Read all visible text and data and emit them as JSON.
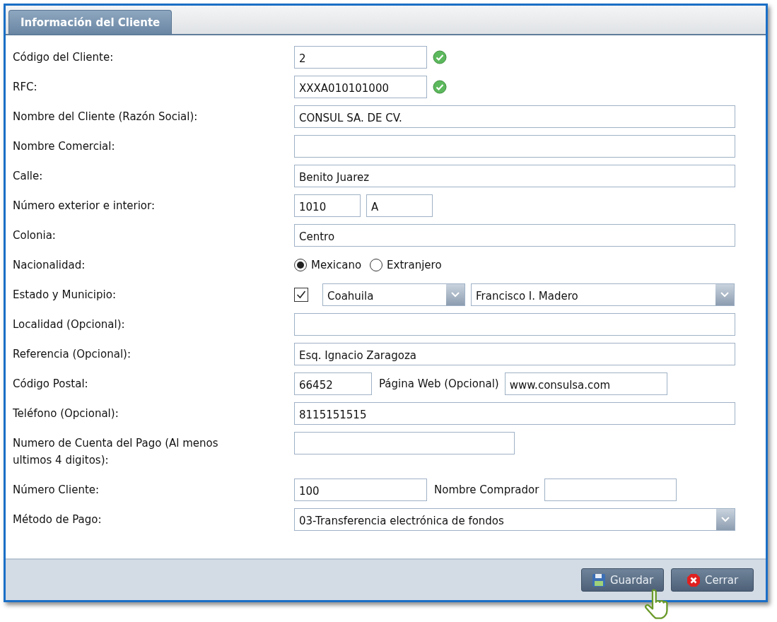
{
  "tab": {
    "label": "Información del Cliente",
    "selected": true
  },
  "rows": [
    {
      "label": "Código del Cliente:",
      "controls": [
        {
          "kind": "validated",
          "value": "2"
        }
      ]
    },
    {
      "label": "RFC:",
      "controls": [
        {
          "kind": "validated",
          "value": "XXXA010101000"
        }
      ]
    },
    {
      "label": "Nombre del Cliente (Razón Social):",
      "controls": [
        {
          "kind": "input",
          "value": "CONSUL SA. DE CV."
        }
      ]
    },
    {
      "label": "Nombre Comercial:",
      "controls": [
        {
          "kind": "input"
        }
      ]
    },
    {
      "label": "Calle:",
      "controls": [
        {
          "kind": "input",
          "value": "Benito Juarez"
        }
      ]
    },
    {
      "label": "Número exterior e interior:",
      "controls": [
        {
          "kind": "input",
          "value": "1010"
        },
        {
          "kind": "input",
          "value": "A"
        }
      ]
    },
    {
      "label": "Colonia:",
      "controls": [
        {
          "kind": "input",
          "value": "Centro"
        }
      ]
    },
    {
      "label": "Nacionalidad:",
      "controls": [
        {
          "kind": "radio",
          "label": "Mexicano",
          "selected": true
        },
        {
          "kind": "radio",
          "label": "Extranjero",
          "selected": false
        }
      ]
    },
    {
      "label": "Estado y Municipio:",
      "controls": [
        {
          "kind": "checkbox",
          "checked": true
        },
        {
          "kind": "select",
          "value": "Coahuila"
        },
        {
          "kind": "select",
          "value": "Francisco I. Madero"
        }
      ]
    },
    {
      "label": "Localidad (Opcional):",
      "controls": [
        {
          "kind": "input"
        }
      ]
    },
    {
      "label": "Referencia (Opcional):",
      "controls": [
        {
          "kind": "input",
          "value": "Esq. Ignacio Zaragoza"
        }
      ]
    },
    {
      "label": "Código Postal:",
      "controls": [
        {
          "kind": "input",
          "value": "66452"
        },
        {
          "kind": "label",
          "text": "Página Web (Opcional)"
        },
        {
          "kind": "input",
          "value": "www.consulsa.com"
        }
      ]
    },
    {
      "label": "Teléfono (Opcional):",
      "controls": [
        {
          "kind": "input",
          "value": "8115151515"
        }
      ]
    },
    {
      "label": "Numero de Cuenta del Pago (Al menos ultimos 4 digitos):",
      "controls": [
        {
          "kind": "input"
        }
      ]
    },
    {
      "label": "Número Cliente:",
      "controls": [
        {
          "kind": "input",
          "value": "100"
        },
        {
          "kind": "label",
          "text": "Nombre Comprador"
        },
        {
          "kind": "input"
        }
      ]
    },
    {
      "label": "Método de Pago:",
      "controls": [
        {
          "kind": "select",
          "value": "03-Transferencia electrónica de fondos"
        }
      ]
    }
  ],
  "buttons": [
    {
      "kind": "save",
      "label": "Guardar"
    },
    {
      "kind": "close",
      "label": "Cerrar"
    }
  ]
}
